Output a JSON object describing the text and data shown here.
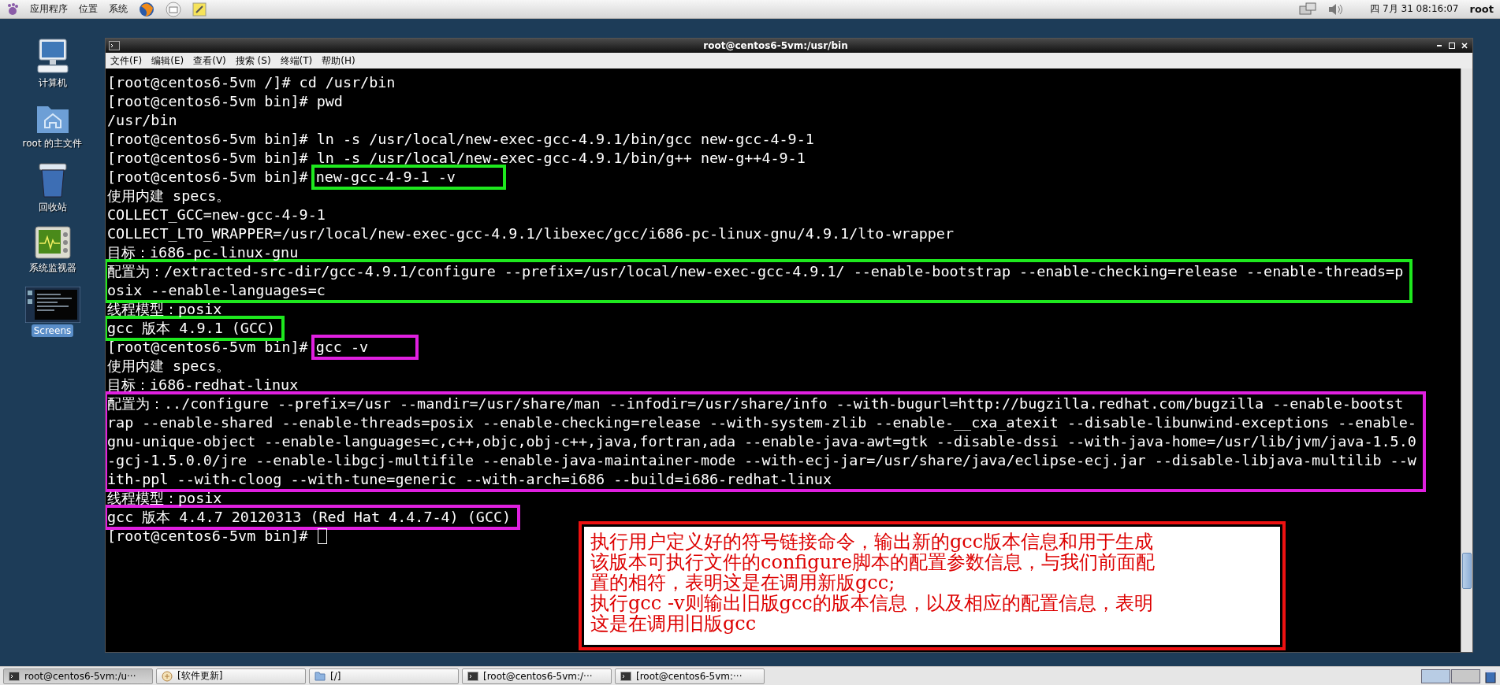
{
  "top_panel": {
    "menus": [
      "应用程序",
      "位置",
      "系统"
    ],
    "clock": "四 7月 31 08:16:07",
    "user": "root"
  },
  "desktop_icons": [
    {
      "kind": "computer",
      "label": "计算机",
      "selected": false
    },
    {
      "kind": "home",
      "label": "root 的主文件",
      "selected": false
    },
    {
      "kind": "trash",
      "label": "回收站",
      "selected": false
    },
    {
      "kind": "monitor",
      "label": "系统监视器",
      "selected": false
    },
    {
      "kind": "screenshot",
      "label": "Screens",
      "selected": true
    }
  ],
  "terminal": {
    "title": "root@centos6-5vm:/usr/bin",
    "menus": [
      "文件(F)",
      "编辑(E)",
      "查看(V)",
      "搜索 (S)",
      "终端(T)",
      "帮助(H)"
    ],
    "blocks": [
      {
        "kind": "output",
        "lines": [
          "[root@centos6-5vm /]# cd /usr/bin",
          "[root@centos6-5vm bin]# pwd",
          "/usr/bin",
          "[root@centos6-5vm bin]# ln -s /usr/local/new-exec-gcc-4.9.1/bin/gcc new-gcc-4-9-1",
          "[root@centos6-5vm bin]# ln -s /usr/local/new-exec-gcc-4.9.1/bin/g++ new-g++4-9-1"
        ]
      },
      {
        "kind": "command",
        "prompt": "[root@centos6-5vm bin]#",
        "command": "new-gcc-4-9-1 -v",
        "color": "#1ee81e"
      },
      {
        "kind": "output",
        "lines": [
          "使用内建 specs。",
          "COLLECT_GCC=new-gcc-4-9-1",
          "COLLECT_LTO_WRAPPER=/usr/local/new-exec-gcc-4.9.1/libexec/gcc/i686-pc-linux-gnu/4.9.1/lto-wrapper",
          "目标：i686-pc-linux-gnu"
        ]
      },
      {
        "kind": "output",
        "color": "#1ee81e",
        "lines": [
          "配置为：/extracted-src-dir/gcc-4.9.1/configure --prefix=/usr/local/new-exec-gcc-4.9.1/ --enable-bootstrap --enable-checking=release --enable-threads=p",
          "osix --enable-languages=c"
        ]
      },
      {
        "kind": "output",
        "lines": [
          "线程模型：posix"
        ]
      },
      {
        "kind": "output",
        "color": "#1ee81e",
        "lines": [
          "gcc 版本 4.9.1 (GCC)"
        ]
      },
      {
        "kind": "command",
        "prompt": "[root@centos6-5vm bin]#",
        "command": "gcc -v",
        "color": "#e020e0"
      },
      {
        "kind": "output",
        "lines": [
          "使用内建 specs。",
          "目标：i686-redhat-linux"
        ]
      },
      {
        "kind": "output",
        "color": "#e020e0",
        "lines": [
          "配置为：../configure --prefix=/usr --mandir=/usr/share/man --infodir=/usr/share/info --with-bugurl=http://bugzilla.redhat.com/bugzilla --enable-bootst",
          "rap --enable-shared --enable-threads=posix --enable-checking=release --with-system-zlib --enable-__cxa_atexit --disable-libunwind-exceptions --enable-",
          "gnu-unique-object --enable-languages=c,c++,objc,obj-c++,java,fortran,ada --enable-java-awt=gtk --disable-dssi --with-java-home=/usr/lib/jvm/java-1.5.0",
          "-gcj-1.5.0.0/jre --enable-libgcj-multifile --enable-java-maintainer-mode --with-ecj-jar=/usr/share/java/eclipse-ecj.jar --disable-libjava-multilib --w",
          "ith-ppl --with-cloog --with-tune=generic --with-arch=i686 --build=i686-redhat-linux"
        ]
      },
      {
        "kind": "output",
        "lines": [
          "线程模型：posix"
        ]
      },
      {
        "kind": "output",
        "color": "#e020e0",
        "lines": [
          "gcc 版本 4.4.7 20120313 (Red Hat 4.4.7-4) (GCC)"
        ]
      },
      {
        "kind": "command",
        "prompt": "[root@centos6-5vm bin]#",
        "cursor": true
      }
    ]
  },
  "note": {
    "lines": [
      "执行用户定义好的符号链接命令，输出新的gcc版本信息和用于生成",
      "该版本可执行文件的configure脚本的配置参数信息，与我们前面配",
      "置的相符，表明这是在调用新版gcc;",
      "执行gcc -v则输出旧版gcc的版本信息，以及相应的配置信息，表明",
      "这是在调用旧版gcc"
    ]
  },
  "taskbar": [
    {
      "kind": "terminal",
      "label": "root@centos6-5vm:/u···",
      "selected": true
    },
    {
      "kind": "update",
      "label": "[软件更新]",
      "selected": false
    },
    {
      "kind": "folder",
      "label": "[/]",
      "selected": false
    },
    {
      "kind": "terminal",
      "label": "[root@centos6-5vm:/···",
      "selected": false
    },
    {
      "kind": "terminal",
      "label": "[root@centos6-5vm:···",
      "selected": false
    }
  ]
}
